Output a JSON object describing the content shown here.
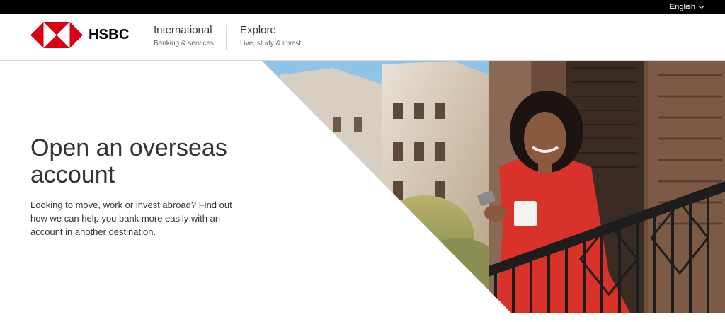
{
  "topbar": {
    "language_label": "English",
    "language_icon": "chevron-down-icon"
  },
  "header": {
    "logo_text": "HSBC",
    "logo_icon": "hsbc-hexagon-logo",
    "brand_red": "#db0011",
    "nav": [
      {
        "title": "International",
        "subtitle": "Banking & services"
      },
      {
        "title": "Explore",
        "subtitle": "Live, study & invest"
      }
    ]
  },
  "hero": {
    "title": "Open an overseas account",
    "description": "Looking to move, work or invest abroad? Find out how we can help you bank more easily with an account in another destination.",
    "image_subject": "woman with coffee and phone on a balcony"
  }
}
